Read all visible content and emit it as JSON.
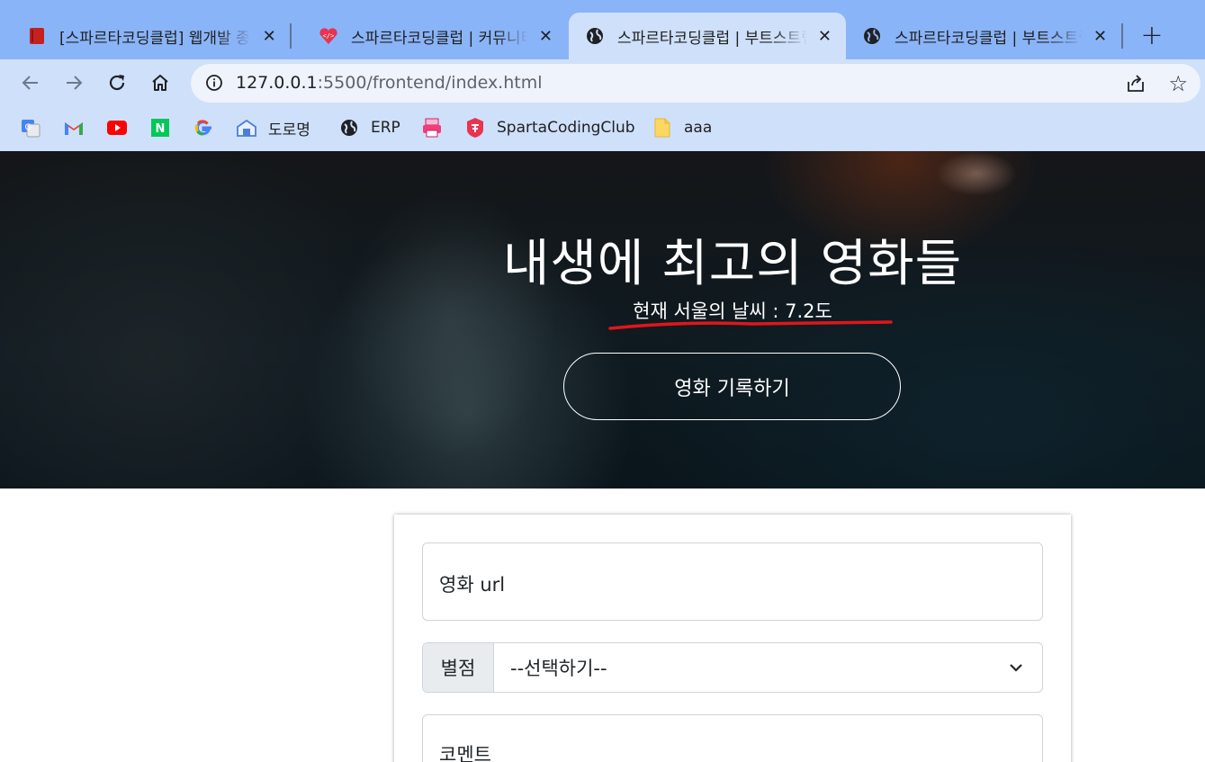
{
  "browser": {
    "tabs": [
      {
        "title": "[스파르타코딩클럽] 웹개발 종합반",
        "icon": "book-icon",
        "active": false
      },
      {
        "title": "스파르타코딩클럽 | 커뮤니티",
        "icon": "code-heart-icon",
        "active": false
      },
      {
        "title": "스파르타코딩클럽 | 부트스트랩",
        "icon": "globe-icon",
        "active": true
      },
      {
        "title": "스파르타코딩클럽 | 부트스트랩",
        "icon": "globe-icon",
        "active": false
      }
    ],
    "new_tab_label": "+",
    "close_glyph": "✕",
    "url_host": "127.0.0.1",
    "url_rest": ":5500/frontend/index.html",
    "bookmarks": [
      {
        "label": "",
        "icon": "translate-icon"
      },
      {
        "label": "",
        "icon": "gmail-icon"
      },
      {
        "label": "",
        "icon": "youtube-icon"
      },
      {
        "label": "",
        "icon": "naver-icon"
      },
      {
        "label": "",
        "icon": "google-icon"
      },
      {
        "label": "도로명",
        "icon": "address-icon"
      },
      {
        "label": "ERP",
        "icon": "globe-icon"
      },
      {
        "label": "",
        "icon": "printer-icon"
      },
      {
        "label": "SpartaCodingClub",
        "icon": "sparta-icon"
      },
      {
        "label": "aaa",
        "icon": "folder-icon"
      }
    ]
  },
  "page": {
    "hero": {
      "title": "내생에 최고의 영화들",
      "weather": "현재 서울의 날씨 : 7.2도",
      "record_button": "영화 기록하기",
      "annotation_color": "#e0161b"
    },
    "form": {
      "url_placeholder": "영화 url",
      "star_label": "별점",
      "star_select": "--선택하기--",
      "comment_placeholder": "코멘트"
    }
  }
}
